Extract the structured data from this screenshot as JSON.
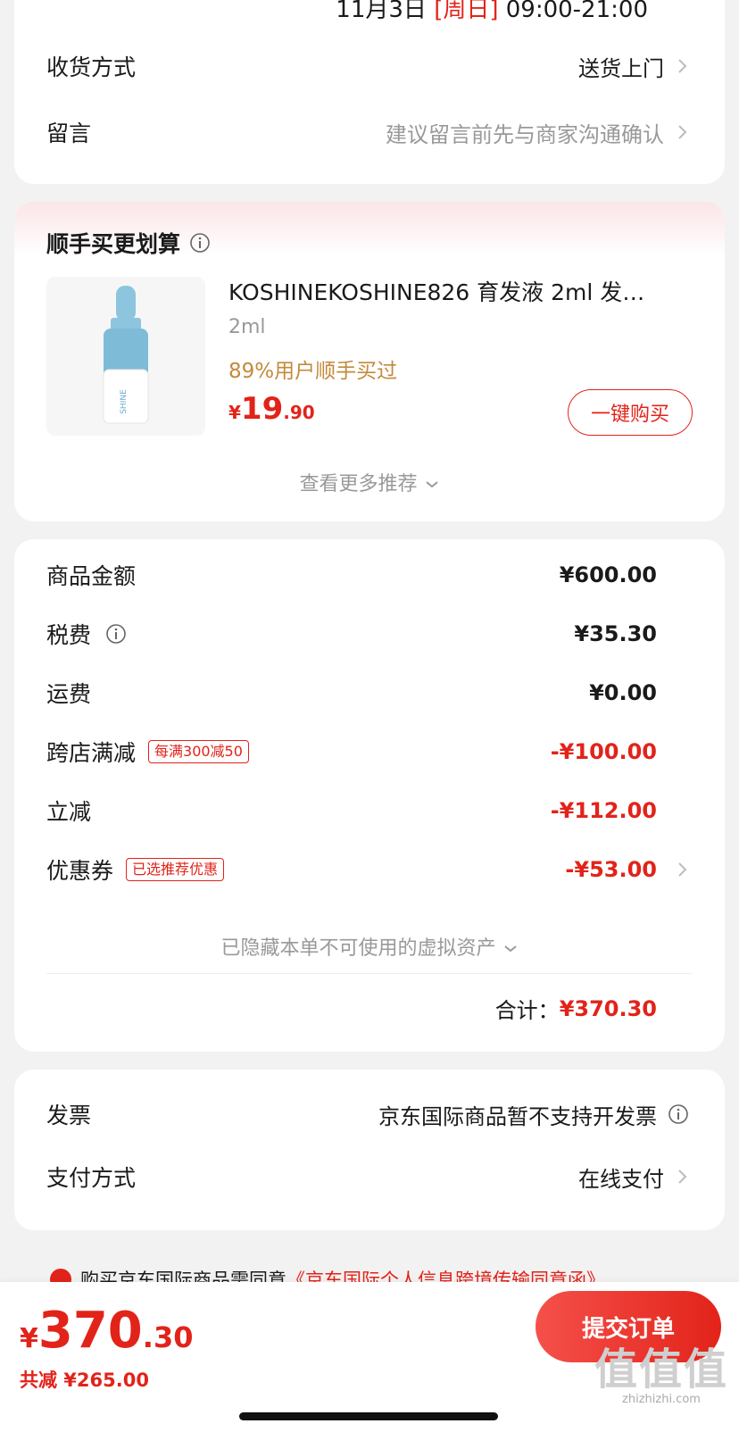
{
  "delivery": {
    "time_date": "11月3日",
    "time_day": "[周日]",
    "time_range": "09:00-21:00",
    "method_label": "收货方式",
    "method_value": "送货上门",
    "note_label": "留言",
    "note_placeholder": "建议留言前先与商家沟通确认"
  },
  "recommend": {
    "title": "顺手买更划算",
    "product_name": "KOSHINEKOSHINE826 育发液 2ml 发…",
    "spec": "2ml",
    "buyers": "89%用户顺手买过",
    "price_symbol": "¥",
    "price_int": "19",
    "price_dec": ".90",
    "buy_button": "一键购买",
    "more": "查看更多推荐",
    "product_image_label": "SHINE"
  },
  "amounts": {
    "goods_label": "商品金额",
    "goods_value": "¥600.00",
    "tax_label": "税费",
    "tax_value": "¥35.30",
    "shipping_label": "运费",
    "shipping_value": "¥0.00",
    "cross_store_label": "跨店满减",
    "cross_store_tag": "每满300减50",
    "cross_store_value": "-¥100.00",
    "instant_label": "立减",
    "instant_value": "-¥112.00",
    "coupon_label": "优惠券",
    "coupon_tag": "已选推荐优惠",
    "coupon_value": "-¥53.00",
    "hidden_assets": "已隐藏本单不可使用的虚拟资产",
    "total_label": "合计：",
    "total_value": "¥370.30"
  },
  "payment": {
    "invoice_label": "发票",
    "invoice_value": "京东国际商品暂不支持开发票",
    "pay_label": "支付方式",
    "pay_value": "在线支付"
  },
  "agreement": {
    "text": "购买京东国际商品需同意",
    "link": "《京东国际个人信息跨境传输同意函》"
  },
  "bottom": {
    "price_symbol": "¥",
    "price_int": "370",
    "price_dec": ".30",
    "saved": "共减 ¥265.00",
    "submit": "提交订单",
    "watermark_glyphs": "值值值",
    "watermark_text": "zhizhizhi.com"
  },
  "colors": {
    "accent": "#e2231a",
    "gold": "#c38a3c",
    "muted": "#999999"
  }
}
